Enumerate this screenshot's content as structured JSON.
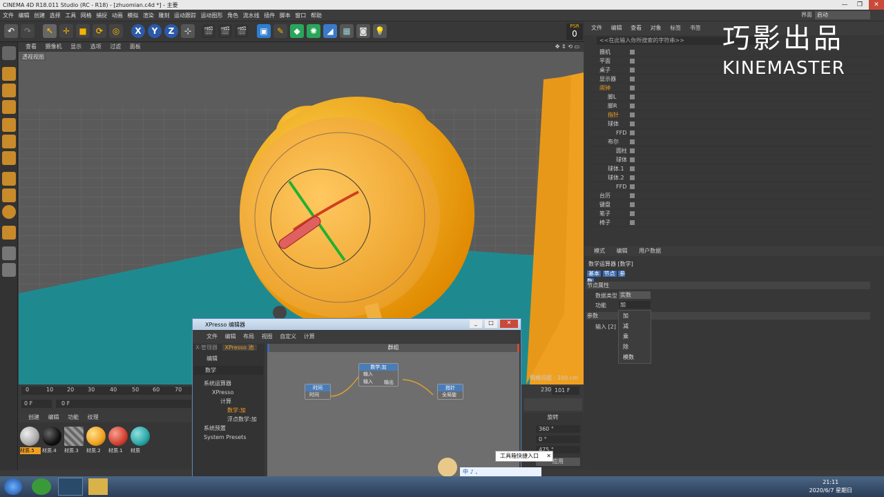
{
  "titlebar": {
    "title": "CINEMA 4D R18.011 Studio (RC - R18) - [zhuomian.c4d *] - 主要",
    "min": "—",
    "max": "❐",
    "close": "✕"
  },
  "menubar": {
    "items": [
      "文件",
      "编辑",
      "创建",
      "选择",
      "工具",
      "网格",
      "捕捉",
      "动画",
      "模拟",
      "渲染",
      "雕刻",
      "运动跟踪",
      "运动图形",
      "角色",
      "流水线",
      "插件",
      "脚本",
      "窗口",
      "帮助"
    ],
    "layout_label": "界面",
    "layout_value": "启动"
  },
  "psr": {
    "label": "PSR",
    "value": "0"
  },
  "viewport": {
    "menu": [
      "查看",
      "摄像机",
      "显示",
      "选项",
      "过滤",
      "面板"
    ],
    "label": "透视视图",
    "grid_info": "网格间距 : 100 cm"
  },
  "timeline": {
    "ticks": [
      "0",
      "10",
      "20",
      "30",
      "40",
      "50",
      "60",
      "70"
    ],
    "frame_start": "0 F",
    "frame_field": "0 F",
    "end_frame": "101 F",
    "tick_230": "230"
  },
  "materials": {
    "menu": [
      "创建",
      "编辑",
      "功能",
      "纹理"
    ],
    "items": [
      {
        "name": "材质.5",
        "color": "#aaaaaa"
      },
      {
        "name": "材质.4",
        "color": "#111111"
      },
      {
        "name": "材质.3",
        "color": "#999999"
      },
      {
        "name": "材质.2",
        "color": "#f0a020"
      },
      {
        "name": "材质.1",
        "color": "#d04030"
      },
      {
        "name": "材质",
        "color": "#2aa5a5"
      }
    ]
  },
  "coords": {
    "header": "旋转",
    "h": "360 °",
    "p": "0 °",
    "b": "475 °",
    "apply": "应用"
  },
  "objects": {
    "menu": [
      "文件",
      "编辑",
      "查看",
      "对象",
      "标签",
      "书签"
    ],
    "search": "<<在此输入你所搜索的字符串>>",
    "rows": [
      {
        "name": "摄机",
        "indent": 0
      },
      {
        "name": "平面",
        "indent": 0
      },
      {
        "name": "桌子",
        "indent": 0
      },
      {
        "name": "显示器",
        "indent": 0
      },
      {
        "name": "闹钟",
        "indent": 0,
        "active": true
      },
      {
        "name": "脚L",
        "indent": 1
      },
      {
        "name": "脚R",
        "indent": 1
      },
      {
        "name": "指针",
        "indent": 1
      },
      {
        "name": "球体",
        "indent": 1
      },
      {
        "name": "FFD",
        "indent": 2
      },
      {
        "name": "布尔",
        "indent": 1
      },
      {
        "name": "圆柱",
        "indent": 2
      },
      {
        "name": "球体",
        "indent": 2
      },
      {
        "name": "球体.1",
        "indent": 1
      },
      {
        "name": "球体.2",
        "indent": 1
      },
      {
        "name": "FFD",
        "indent": 2
      },
      {
        "name": "台历",
        "indent": 0
      },
      {
        "name": "键盘",
        "indent": 0
      },
      {
        "name": "笔子",
        "indent": 0
      },
      {
        "name": "椅子",
        "indent": 0
      }
    ]
  },
  "attributes": {
    "menu": [
      "模式",
      "编辑",
      "用户数据"
    ],
    "title": "数学运算器 [数学]",
    "tabs": [
      "基本",
      "节点",
      "参数"
    ],
    "section": "节点属性",
    "datatype_label": "数据类型",
    "datatype_value": "实数",
    "func_label": "功能",
    "func_value": "加",
    "params_label": "参数",
    "input_label": "输入 [2]",
    "dropdown": [
      "加",
      "减",
      "乘",
      "除",
      "模数"
    ]
  },
  "logo": {
    "line1": "巧影出品",
    "line2": "KINEMASTER"
  },
  "xpresso": {
    "title": "XPresso 编辑器",
    "menu": [
      "文件",
      "编辑",
      "布局",
      "视图",
      "自定义",
      "计算"
    ],
    "tabs": [
      "X-管理器",
      "XPresso 池"
    ],
    "pool_head": "编辑",
    "search": "数学",
    "tree": [
      "系统运算器",
      "XPresso",
      "计算",
      "数学:加",
      "浮点数学:加",
      "系统预置",
      "System Presets"
    ],
    "group_label": "群组",
    "nodes": {
      "time": {
        "title": "时间",
        "port": "时间"
      },
      "math": {
        "title": "数学:加",
        "in1": "输入",
        "in2": "输入",
        "out": "输出"
      },
      "pointer": {
        "title": "指针",
        "port": "全局旋"
      }
    }
  },
  "tooltip": {
    "text": "工具箱快捷入口",
    "close": "✕"
  },
  "ime": {
    "chars": "中 ♪ 、"
  },
  "taskbar": {
    "time": "21:11",
    "date": "2020/6/7 星期日"
  }
}
